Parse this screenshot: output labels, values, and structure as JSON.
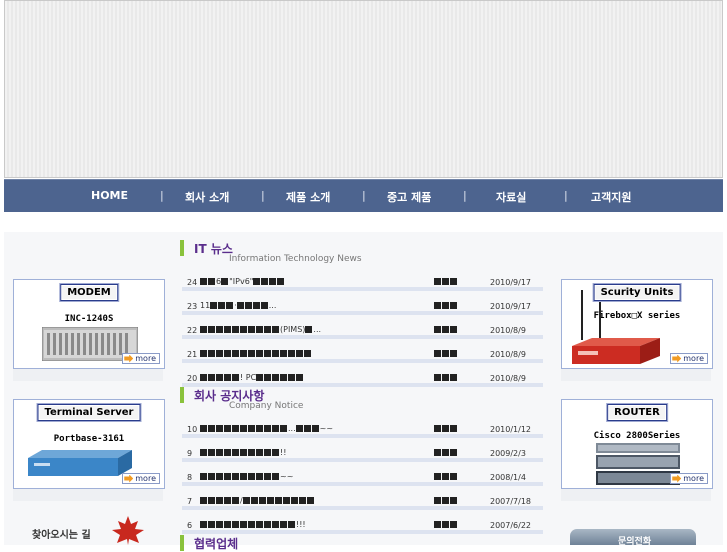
{
  "nav": {
    "items": [
      "HOME",
      "회사 소개",
      "제품 소개",
      "중고 제품",
      "자료실",
      "고객지원"
    ],
    "separator": "|"
  },
  "it_news": {
    "title": "IT 뉴스",
    "subtitle": "Information Technology News",
    "rows": [
      {
        "num": "24",
        "prefix_squares": 2,
        "text_mid": "6",
        "mid_squares": 1,
        "text": "\"IPv6\"",
        "tail_squares": 4,
        "suffix": "",
        "author_squares": 3,
        "date": "2010/9/17"
      },
      {
        "num": "23",
        "prefix_squares": 0,
        "text_mid": "11",
        "mid_squares": 3,
        "text": "·",
        "tail_squares": 4,
        "suffix": "...",
        "author_squares": 3,
        "date": "2010/9/17"
      },
      {
        "num": "22",
        "prefix_squares": 10,
        "text_mid": "",
        "mid_squares": 0,
        "text": "(PIMS)",
        "tail_squares": 1,
        "suffix": "...",
        "author_squares": 3,
        "date": "2010/8/9"
      },
      {
        "num": "21",
        "prefix_squares": 4,
        "text_mid": "",
        "mid_squares": 4,
        "text": "",
        "tail_squares": 6,
        "suffix": "",
        "author_squares": 3,
        "date": "2010/8/9"
      },
      {
        "num": "20",
        "prefix_squares": 5,
        "text_mid": "",
        "mid_squares": 0,
        "text": "! PC",
        "tail_squares": 6,
        "suffix": "",
        "author_squares": 3,
        "date": "2010/8/9"
      }
    ]
  },
  "notice": {
    "title": "회사 공지사항",
    "subtitle": "Company Notice",
    "rows": [
      {
        "num": "10",
        "prefix_squares": 11,
        "text_mid": "",
        "mid_squares": 0,
        "text": "...",
        "tail_squares": 3,
        "suffix": "~~",
        "author_squares": 3,
        "date": "2010/1/12"
      },
      {
        "num": "9",
        "prefix_squares": 4,
        "text_mid": "",
        "mid_squares": 0,
        "text": "",
        "tail_squares": 6,
        "suffix": "!!",
        "author_squares": 3,
        "date": "2009/2/3"
      },
      {
        "num": "8",
        "prefix_squares": 4,
        "text_mid": "",
        "mid_squares": 0,
        "text": "",
        "tail_squares": 6,
        "suffix": "~~",
        "author_squares": 3,
        "date": "2008/1/4"
      },
      {
        "num": "7",
        "prefix_squares": 5,
        "text_mid": "",
        "mid_squares": 0,
        "text": "/",
        "tail_squares": 9,
        "suffix": "",
        "author_squares": 3,
        "date": "2007/7/18"
      },
      {
        "num": "6",
        "prefix_squares": 10,
        "text_mid": "",
        "mid_squares": 0,
        "text": "",
        "tail_squares": 2,
        "suffix": "!!!",
        "author_squares": 3,
        "date": "2007/6/22"
      }
    ]
  },
  "partners_title": "협력업체",
  "cards": {
    "modem": {
      "label": "MODEM",
      "model": "INC-1240S",
      "more": "more"
    },
    "terminal": {
      "label": "Terminal Server",
      "model": "Portbase-3161",
      "more": "more"
    },
    "security": {
      "label": "Scurity Units",
      "model": "Firebox□X series",
      "more": "more"
    },
    "router": {
      "label": "ROUTER",
      "model": "Cisco 2800Series",
      "more": "more"
    }
  },
  "directions": "찾아오시는 길",
  "inquiry": "문의전화",
  "colors": {
    "nav": "#4d648f",
    "section_bar": "#8ac23c",
    "section_title": "#5a2d8c",
    "row_line": "#dde3f0"
  }
}
